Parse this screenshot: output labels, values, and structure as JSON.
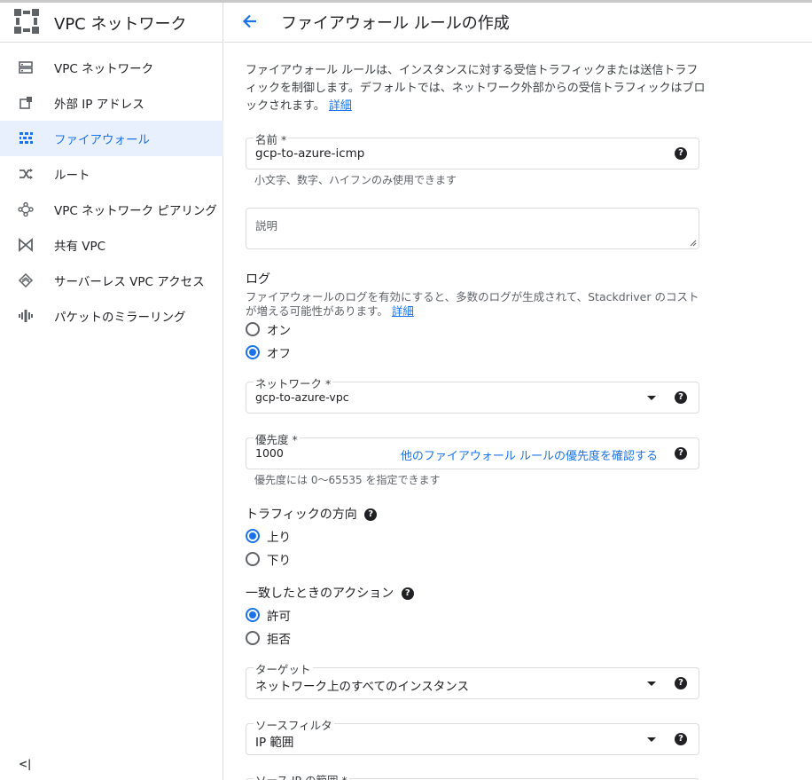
{
  "sidebar": {
    "title": "VPC ネットワーク",
    "items": [
      {
        "label": "VPC ネットワーク",
        "icon": "vpc-network-icon",
        "active": false
      },
      {
        "label": "外部 IP アドレス",
        "icon": "external-ip-icon",
        "active": false
      },
      {
        "label": "ファイアウォール",
        "icon": "firewall-icon",
        "active": true
      },
      {
        "label": "ルート",
        "icon": "routes-icon",
        "active": false
      },
      {
        "label": "VPC ネットワーク ピアリング",
        "icon": "peering-icon",
        "active": false
      },
      {
        "label": "共有 VPC",
        "icon": "shared-vpc-icon",
        "active": false
      },
      {
        "label": "サーバーレス VPC アクセス",
        "icon": "serverless-icon",
        "active": false
      },
      {
        "label": "パケットのミラーリング",
        "icon": "packet-mirroring-icon",
        "active": false
      }
    ],
    "collapse_label": "<|"
  },
  "header": {
    "title": "ファイアウォール ルールの作成"
  },
  "form": {
    "intro_text": "ファイアウォール ルールは、インスタンスに対する受信トラフィックまたは送信トラフィックを制御します。デフォルトでは、ネットワーク外部からの受信トラフィックはブロックされます。",
    "intro_link": "詳細",
    "name": {
      "label": "名前 *",
      "value": "gcp-to-azure-icmp",
      "hint": "小文字、数字、ハイフンのみ使用できます"
    },
    "description": {
      "placeholder": "説明"
    },
    "logs": {
      "title": "ログ",
      "desc": "ファイアウォールのログを有効にすると、多数のログが生成されて、Stackdriver のコストが増える可能性があります。",
      "link": "詳細",
      "options": [
        {
          "label": "オン",
          "checked": false
        },
        {
          "label": "オフ",
          "checked": true
        }
      ]
    },
    "network": {
      "label": "ネットワーク *",
      "value": "gcp-to-azure-vpc"
    },
    "priority": {
      "label": "優先度 *",
      "value": "1000",
      "link": "他のファイアウォール ルールの優先度を確認する",
      "hint": "優先度には 0〜65535 を指定できます"
    },
    "direction": {
      "title": "トラフィックの方向",
      "options": [
        {
          "label": "上り",
          "checked": true
        },
        {
          "label": "下り",
          "checked": false
        }
      ]
    },
    "action": {
      "title": "一致したときのアクション",
      "options": [
        {
          "label": "許可",
          "checked": true
        },
        {
          "label": "拒否",
          "checked": false
        }
      ]
    },
    "targets": {
      "label": "ターゲット",
      "value": "ネットワーク上のすべてのインスタンス"
    },
    "source_filter": {
      "label": "ソースフィルタ",
      "value": "IP 範囲"
    },
    "source_ip": {
      "label": "ソース IP の範囲 *"
    }
  },
  "colors": {
    "accent": "#1a73e8",
    "active_bg": "#e8f0fe",
    "border": "#dadce0"
  }
}
